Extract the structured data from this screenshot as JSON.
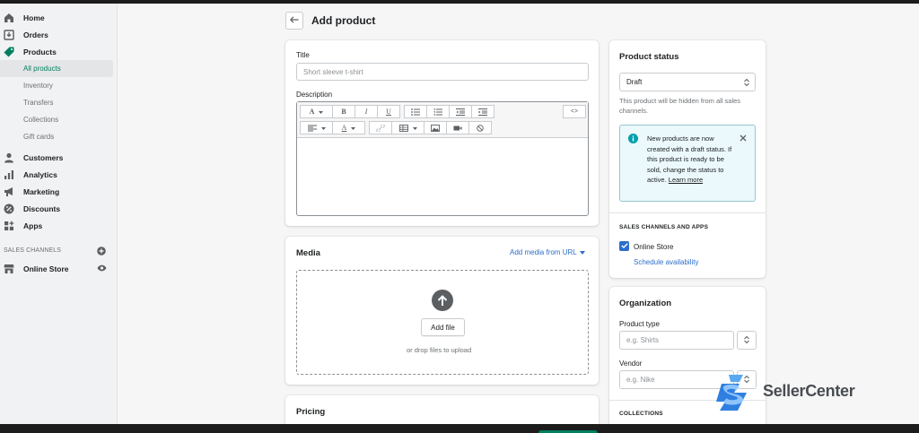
{
  "sidebar": {
    "items": [
      {
        "label": "Home",
        "icon": "home-icon"
      },
      {
        "label": "Orders",
        "icon": "orders-icon"
      },
      {
        "label": "Products",
        "icon": "tag-icon"
      },
      {
        "label": "All products",
        "sub": true,
        "active": true
      },
      {
        "label": "Inventory",
        "sub": true
      },
      {
        "label": "Transfers",
        "sub": true
      },
      {
        "label": "Collections",
        "sub": true
      },
      {
        "label": "Gift cards",
        "sub": true
      },
      {
        "label": "Customers",
        "icon": "customers-icon"
      },
      {
        "label": "Analytics",
        "icon": "analytics-icon"
      },
      {
        "label": "Marketing",
        "icon": "marketing-icon"
      },
      {
        "label": "Discounts",
        "icon": "discount-icon"
      },
      {
        "label": "Apps",
        "icon": "apps-icon"
      }
    ],
    "sales_channels_label": "SALES CHANNELS",
    "online_store_label": "Online Store"
  },
  "page": {
    "title": "Add product"
  },
  "title_card": {
    "title_label": "Title",
    "title_placeholder": "Short sleeve t-shirt",
    "description_label": "Description",
    "toolbar": {
      "code_label": "<>",
      "bold": "B",
      "italic": "I",
      "underline": "U",
      "font": "A",
      "color": "A"
    }
  },
  "media_card": {
    "title": "Media",
    "add_from_url": "Add media from URL",
    "add_file": "Add file",
    "drop_hint": "or drop files to upload"
  },
  "pricing_card": {
    "title": "Pricing"
  },
  "status_card": {
    "title": "Product status",
    "status_value": "Draft",
    "status_help": "This product will be hidden from all sales channels.",
    "banner_text": "New products are now created with a draft status. If this product is ready to be sold, change the status to active.",
    "banner_link": "Learn more",
    "channels_header": "SALES CHANNELS AND APPS",
    "online_store": "Online Store",
    "schedule": "Schedule availability"
  },
  "organization_card": {
    "title": "Organization",
    "product_type_label": "Product type",
    "product_type_placeholder": "e.g. Shirts",
    "vendor_label": "Vendor",
    "vendor_placeholder": "e.g. Nike",
    "collections_header": "COLLECTIONS"
  },
  "watermark": {
    "text": "SellerCenter"
  },
  "colors": {
    "accent": "#008060",
    "link": "#2c6ecb",
    "banner_bg": "#ebf9fc",
    "sidebar_bg": "#f1f2f3"
  }
}
